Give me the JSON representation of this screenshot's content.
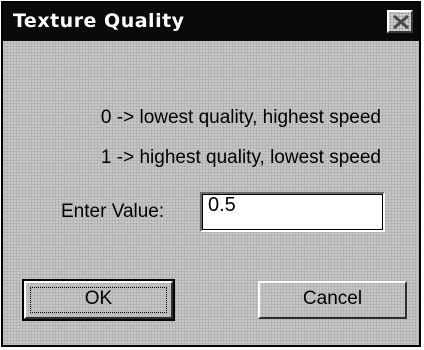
{
  "dialog": {
    "title": "Texture Quality",
    "close_icon": "close-icon",
    "info_lines": [
      "0 -> lowest quality, highest speed",
      "1 -> highest quality, lowest speed"
    ],
    "value_label": "Enter Value:",
    "value_input": "0.5",
    "buttons": {
      "ok": "OK",
      "cancel": "Cancel"
    }
  },
  "colors": {
    "titlebar": "#0a0a0a",
    "dialog_background": "#c6c6c6",
    "input_background": "#ffffff"
  }
}
